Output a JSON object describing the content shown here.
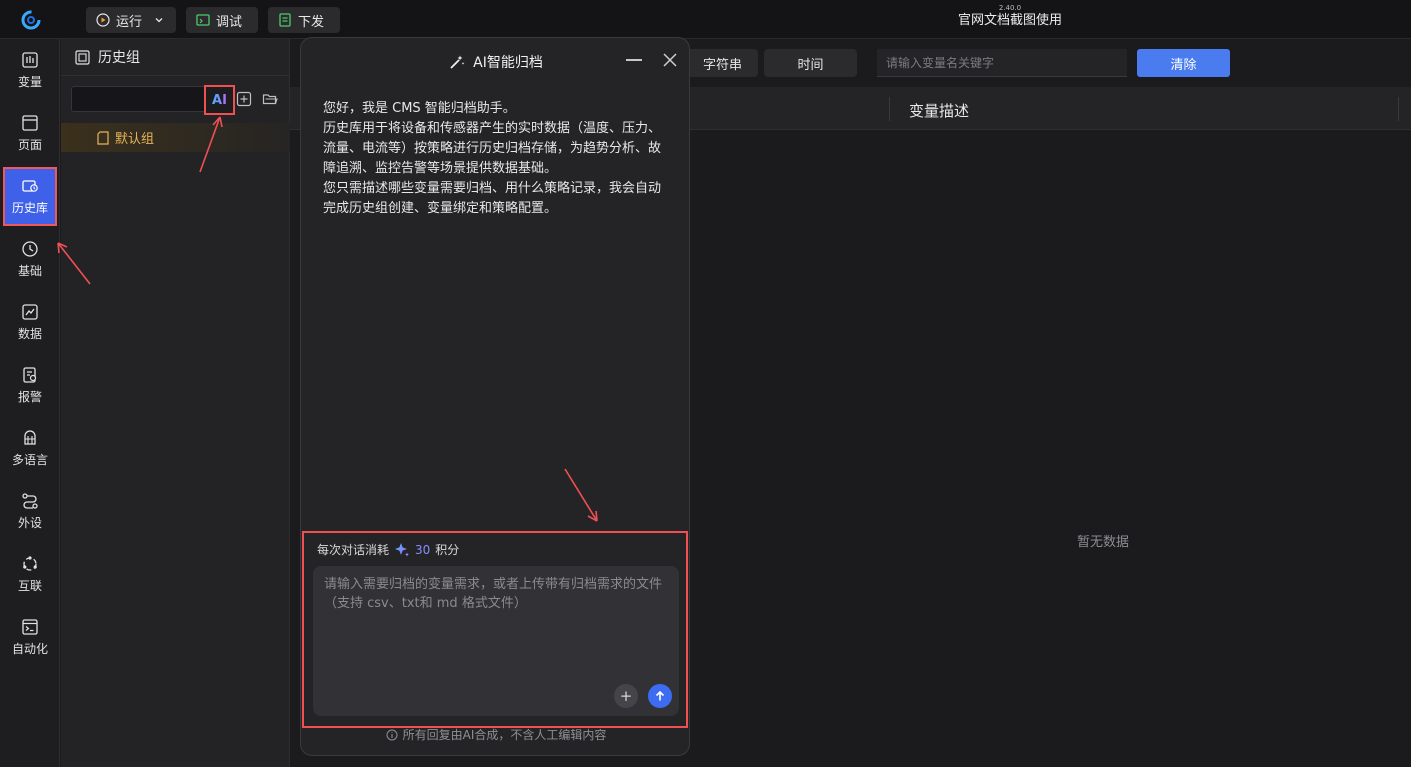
{
  "app": {
    "version": "2.40.0",
    "title": "官网文档截图使用"
  },
  "toolbar": {
    "run_label": "运行",
    "debug_label": "调试",
    "deploy_label": "下发"
  },
  "nav": {
    "items": [
      {
        "label": "变量",
        "icon": "variable-icon"
      },
      {
        "label": "页面",
        "icon": "page-icon"
      },
      {
        "label": "历史库",
        "icon": "history-db-icon",
        "active": true
      },
      {
        "label": "基础",
        "icon": "clock-icon"
      },
      {
        "label": "数据",
        "icon": "data-icon"
      },
      {
        "label": "报警",
        "icon": "alarm-icon"
      },
      {
        "label": "多语言",
        "icon": "language-icon"
      },
      {
        "label": "外设",
        "icon": "peripheral-icon"
      },
      {
        "label": "互联",
        "icon": "interconnect-icon"
      },
      {
        "label": "自动化",
        "icon": "automation-icon"
      }
    ]
  },
  "history_panel": {
    "title": "历史组",
    "ai_label": "AI",
    "groups": [
      {
        "label": "默认组"
      }
    ]
  },
  "main": {
    "filter_string": "字符串",
    "filter_time": "时间",
    "search_placeholder": "请输入变量名关键字",
    "clear_label": "清除",
    "column_desc": "变量描述",
    "empty_text": "暂无数据"
  },
  "dialog": {
    "title": "AI智能归档",
    "messages": [
      "您好，我是 CMS 智能归档助手。",
      "历史库用于将设备和传感器产生的实时数据（温度、压力、流量、电流等）按策略进行历史归档存储，为趋势分析、故障追溯、监控告警等场景提供数据基础。",
      "您只需描述哪些变量需要归档、用什么策略记录，我会自动完成历史组创建、变量绑定和策略配置。"
    ],
    "cost_prefix": "每次对话消耗",
    "cost_value": "30",
    "cost_suffix": "积分",
    "input_placeholder": "请输入需要归档的变量需求，或者上传带有归档需求的文件（支持 csv、txt和 md 格式文件）",
    "plus_label": "+",
    "disclaimer": "所有回复由AI合成，不含人工编辑内容"
  },
  "colors": {
    "accent": "#4a7cf0",
    "nav_active": "#3f60e8",
    "annotation": "#f05052",
    "group_text": "#e8b45a"
  }
}
